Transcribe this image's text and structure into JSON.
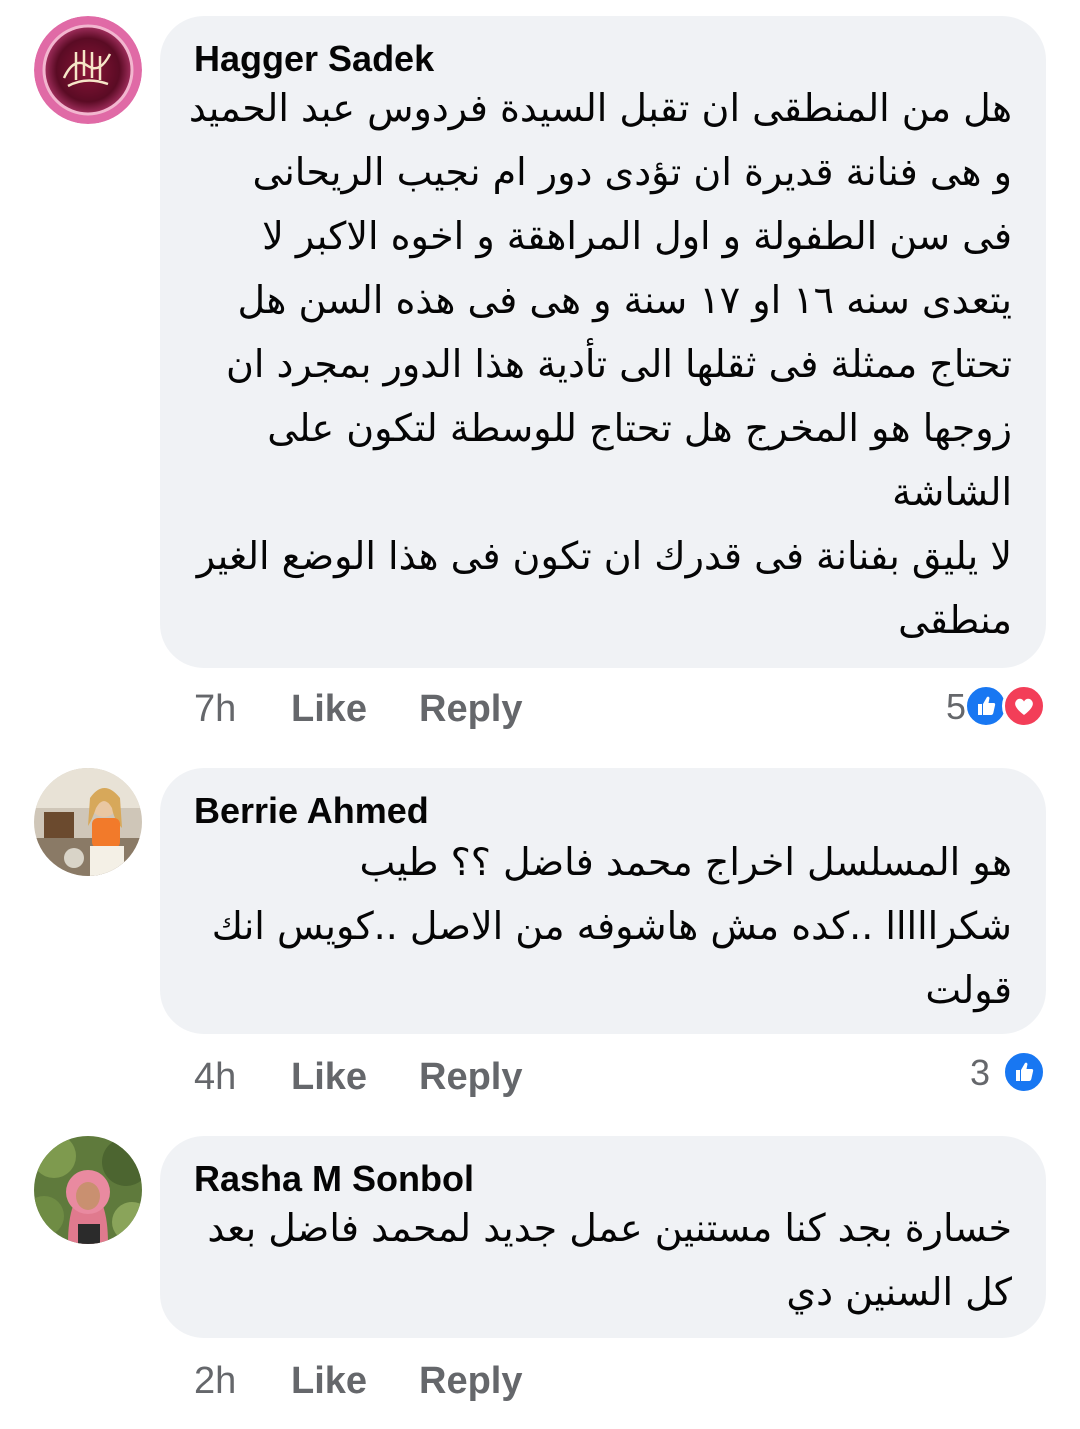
{
  "comments": [
    {
      "author": "Hagger Sadek",
      "lines": [
        "هل من المنطقى ان تقبل السيدة فردوس عبد الحميد",
        "و هى فنانة قديرة ان تؤدى دور ام نجيب الريحانى",
        "فى سن الطفولة و اول المراهقة و اخوه الاكبر لا",
        "يتعدى سنه ١٦ او ١٧ سنة  و هى فى هذه السن هل",
        "تحتاج ممثلة فى ثقلها الى تأدية هذا الدور بمجرد ان",
        "زوجها هو المخرج هل تحتاج للوسطة لتكون على",
        "الشاشة",
        "لا يليق بفنانة فى قدرك ان تكون فى هذا الوضع الغير",
        "منطقى"
      ],
      "time": "7h",
      "like_label": "Like",
      "reply_label": "Reply",
      "reaction_count": "5",
      "reactions": [
        "like-reaction-icon",
        "love-reaction-icon"
      ]
    },
    {
      "author": "Berrie Ahmed",
      "lines": [
        "هو المسلسل اخراج محمد فاضل ؟؟ طيب",
        "شكرااااا ..كده مش هاشوفه من الاصل ..كويس انك",
        "قولت"
      ],
      "time": "4h",
      "like_label": "Like",
      "reply_label": "Reply",
      "reaction_count": "3",
      "reactions": [
        "like-reaction-icon"
      ]
    },
    {
      "author": "Rasha M Sonbol",
      "lines": [
        "خسارة بجد كنا مستنين عمل جديد لمحمد فاضل بعد",
        "كل السنين دي"
      ],
      "time": "2h",
      "like_label": "Like",
      "reply_label": "Reply"
    }
  ],
  "colors": {
    "bubble": "#f0f2f5",
    "text": "#050505",
    "secondary": "#65676b",
    "like_blue": "#1877f2",
    "love_red": "#f33e58"
  }
}
